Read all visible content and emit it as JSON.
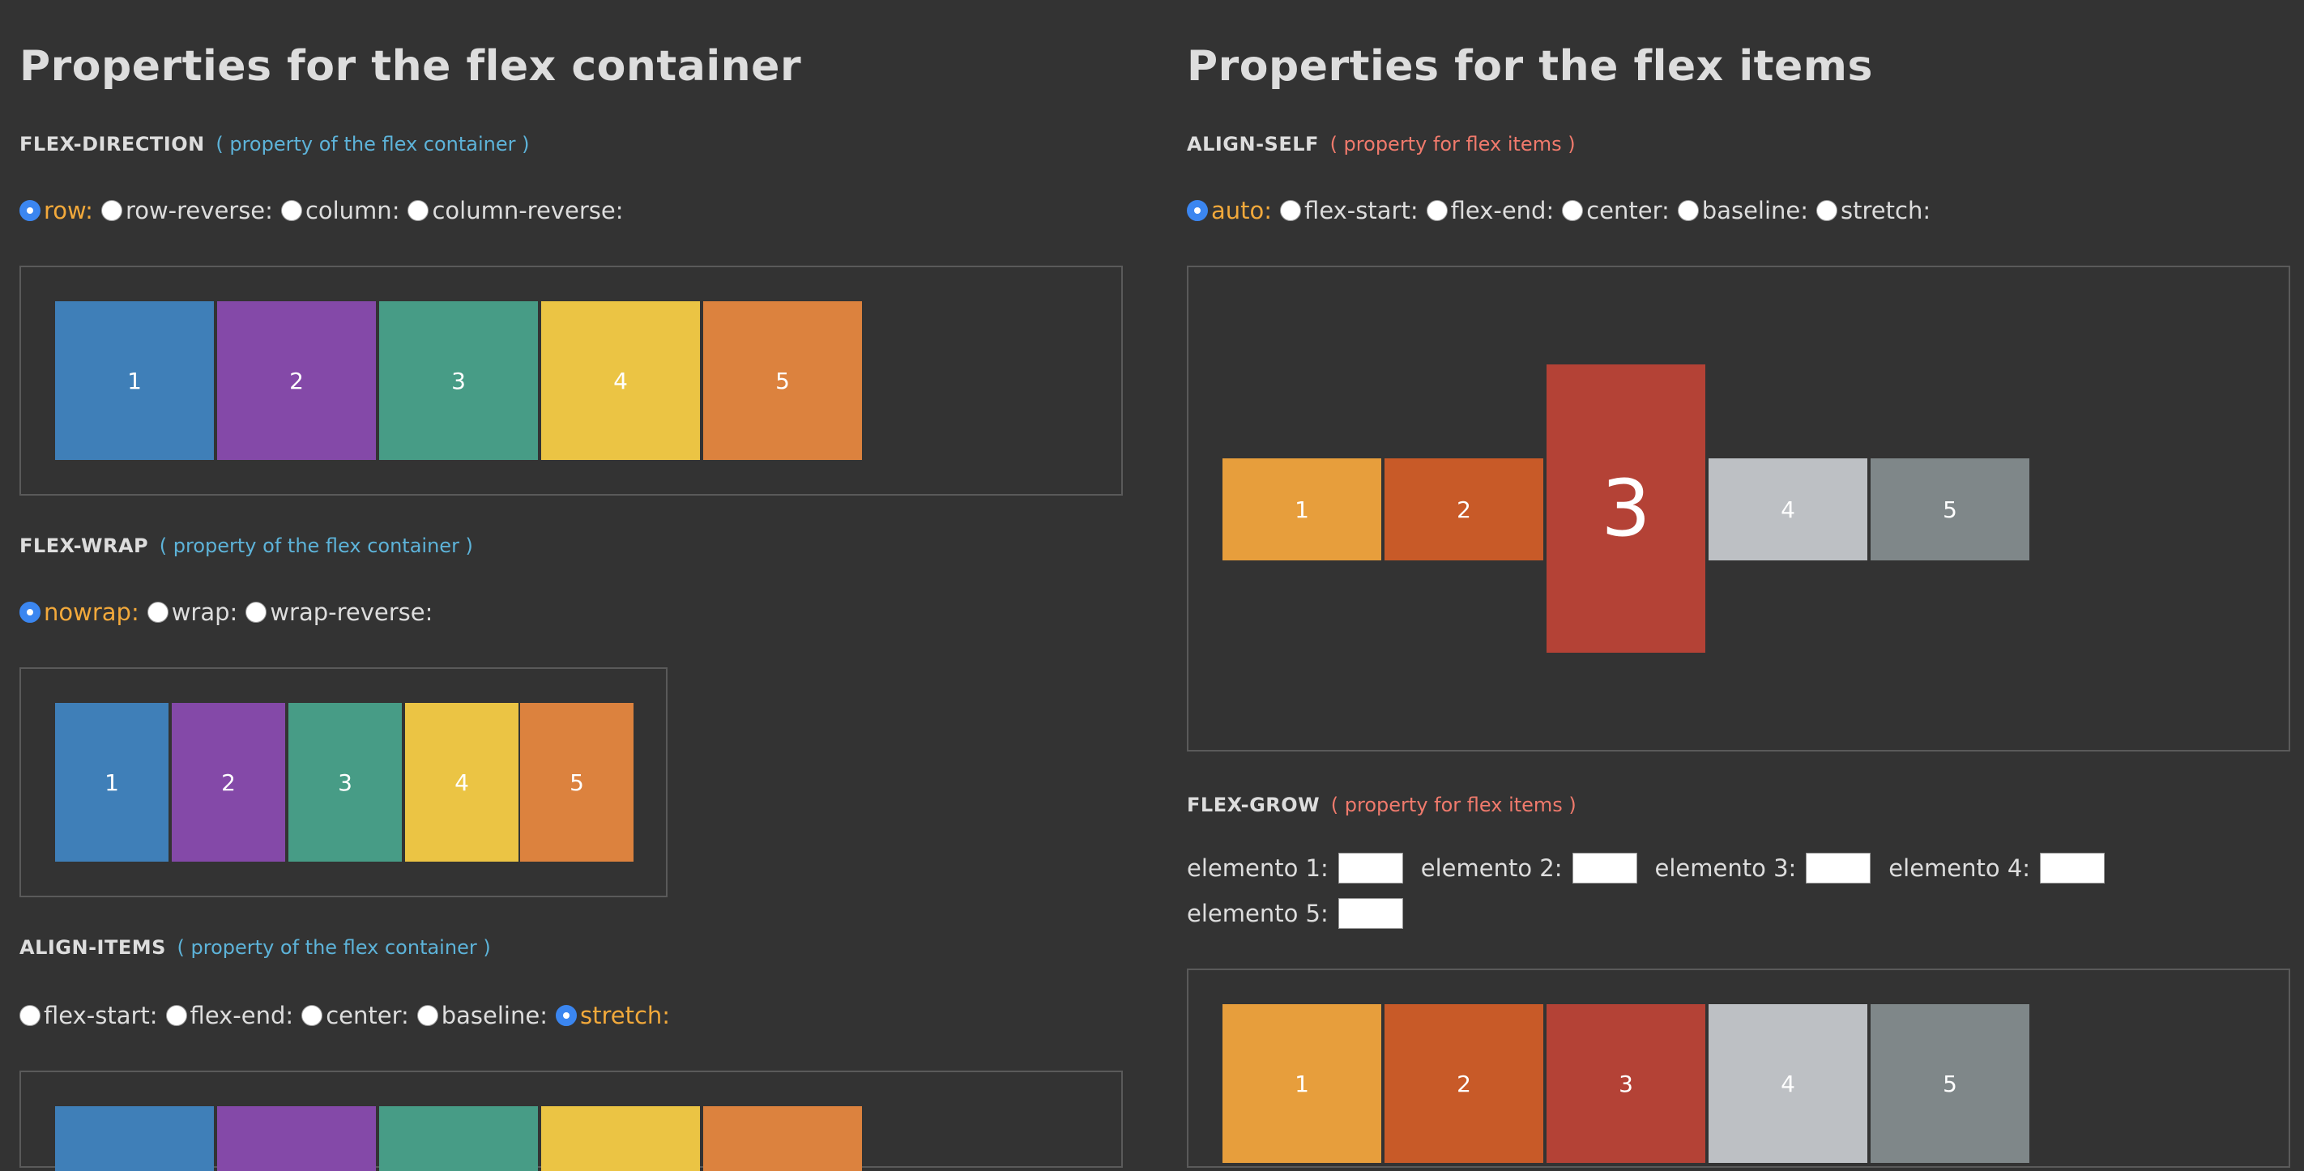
{
  "left": {
    "heading": "Properties for the flex container",
    "flex_direction": {
      "name": "FLEX-DIRECTION",
      "note": "( property of the flex container )",
      "options": [
        "row:",
        "row-reverse:",
        "column:",
        "column-reverse:"
      ],
      "selected": "row:",
      "items": [
        "1",
        "2",
        "3",
        "4",
        "5"
      ]
    },
    "flex_wrap": {
      "name": "FLEX-WRAP",
      "note": "( property of the flex container )",
      "options": [
        "nowrap:",
        "wrap:",
        "wrap-reverse:"
      ],
      "selected": "nowrap:",
      "items": [
        "1",
        "2",
        "3",
        "4",
        "5"
      ]
    },
    "align_items": {
      "name": "ALIGN-ITEMS",
      "note": "( property of the flex container )",
      "options": [
        "flex-start:",
        "flex-end:",
        "center:",
        "baseline:",
        "stretch:"
      ],
      "selected": "stretch:"
    }
  },
  "right": {
    "heading": "Properties for the flex items",
    "align_self": {
      "name": "ALIGN-SELF",
      "note": "( property for flex items )",
      "options": [
        "auto:",
        "flex-start:",
        "flex-end:",
        "center:",
        "baseline:",
        "stretch:"
      ],
      "selected": "auto:",
      "items": [
        "1",
        "2",
        "3",
        "4",
        "5"
      ]
    },
    "flex_grow": {
      "name": "FLEX-GROW",
      "note": "( property for flex items )",
      "fields": [
        {
          "label": "elemento 1:",
          "value": ""
        },
        {
          "label": "elemento 2:",
          "value": ""
        },
        {
          "label": "elemento 3:",
          "value": ""
        },
        {
          "label": "elemento 4:",
          "value": ""
        },
        {
          "label": "elemento 5:",
          "value": ""
        }
      ],
      "items": [
        "1",
        "2",
        "3",
        "4",
        "5"
      ]
    }
  },
  "colors": {
    "background": "#333333",
    "selected_option": "#f2a93b",
    "container_note": "#5db3d9",
    "item_note": "#f07a6c",
    "radio_selected": "#3b86f0"
  }
}
